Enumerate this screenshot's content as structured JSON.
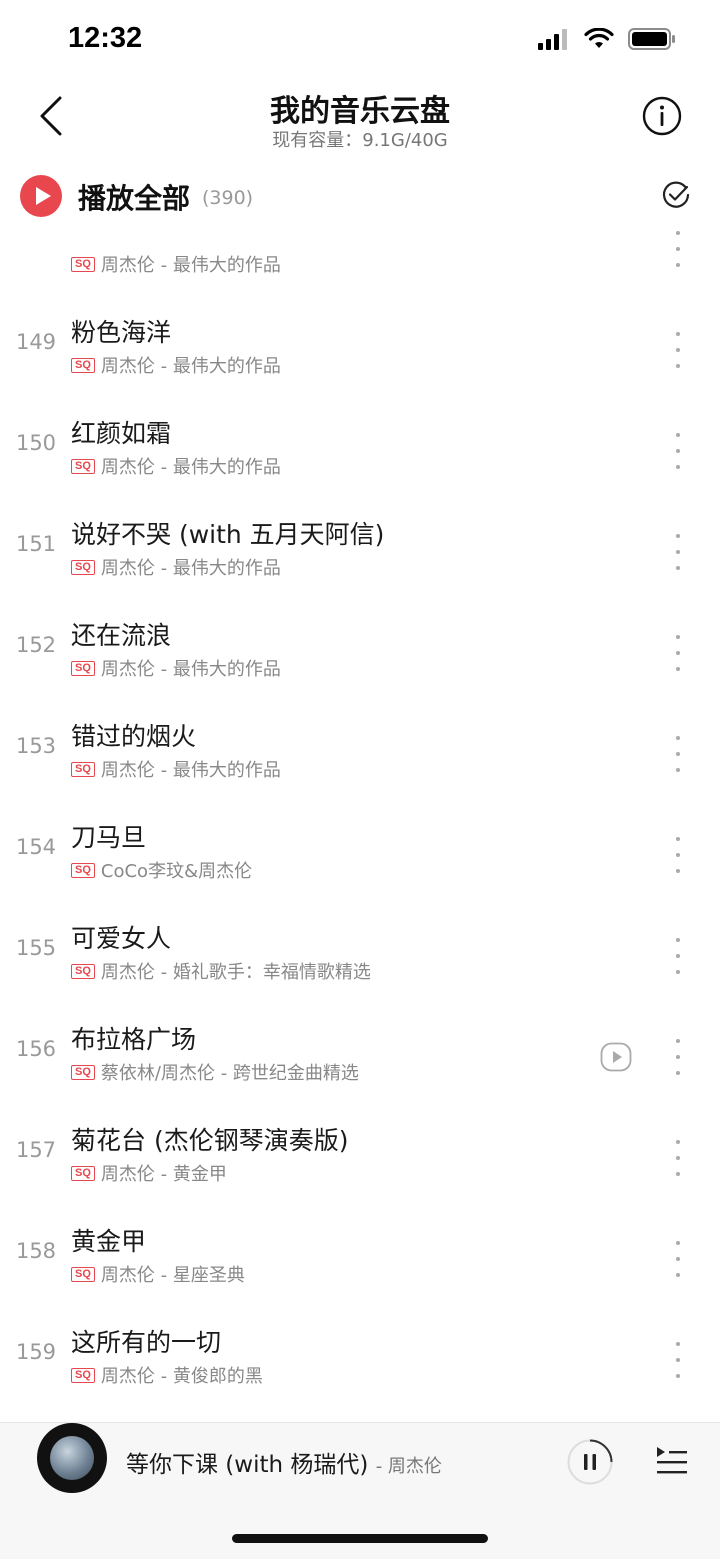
{
  "status_bar": {
    "time": "12:32"
  },
  "header": {
    "title": "我的音乐云盘",
    "capacity": "现有容量：9.1G/40G"
  },
  "play_all": {
    "label": "播放全部",
    "count": "(390)"
  },
  "now_playing_row": {
    "artist_album": "周杰伦 - 最伟大的作品",
    "badge": "SQ"
  },
  "songs": [
    {
      "index": "149",
      "title": "粉色海洋",
      "badge": "SQ",
      "artist_album": "周杰伦 - 最伟大的作品"
    },
    {
      "index": "150",
      "title": "红颜如霜",
      "badge": "SQ",
      "artist_album": "周杰伦 - 最伟大的作品"
    },
    {
      "index": "151",
      "title": "说好不哭 (with 五月天阿信)",
      "badge": "SQ",
      "artist_album": "周杰伦 - 最伟大的作品"
    },
    {
      "index": "152",
      "title": "还在流浪",
      "badge": "SQ",
      "artist_album": "周杰伦 - 最伟大的作品"
    },
    {
      "index": "153",
      "title": "错过的烟火",
      "badge": "SQ",
      "artist_album": "周杰伦 - 最伟大的作品"
    },
    {
      "index": "154",
      "title": "刀马旦",
      "badge": "SQ",
      "artist_album": "CoCo李玟&周杰伦"
    },
    {
      "index": "155",
      "title": "可爱女人",
      "badge": "SQ",
      "artist_album": "周杰伦 - 婚礼歌手：幸福情歌精选"
    },
    {
      "index": "156",
      "title": "布拉格广场",
      "badge": "SQ",
      "artist_album": "蔡依林/周杰伦 - 跨世纪金曲精选",
      "has_mv": true
    },
    {
      "index": "157",
      "title": "菊花台 (杰伦钢琴演奏版)",
      "badge": "SQ",
      "artist_album": "周杰伦 - 黄金甲"
    },
    {
      "index": "158",
      "title": "黄金甲",
      "badge": "SQ",
      "artist_album": "周杰伦 - 星座圣典"
    },
    {
      "index": "159",
      "title": "这所有的一切",
      "badge": "SQ",
      "artist_album": "周杰伦 - 黄俊郎的黑"
    }
  ],
  "mini_player": {
    "title": "等你下课 (with 杨瑞代)",
    "artist": "- 周杰伦"
  },
  "colors": {
    "accent": "#e8474e",
    "secondary_text": "#888888"
  }
}
